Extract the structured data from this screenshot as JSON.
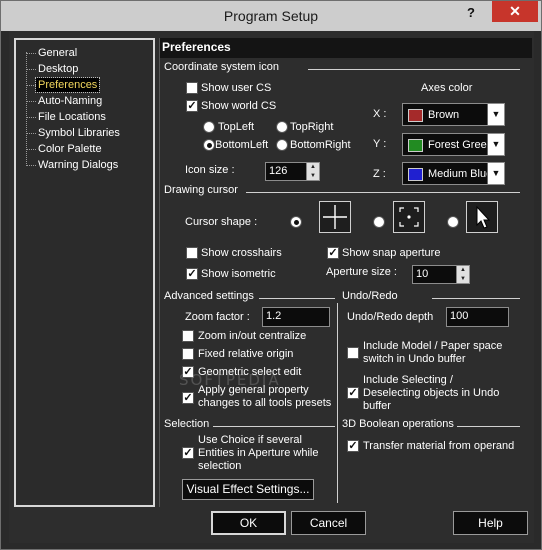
{
  "window": {
    "title": "Program Setup",
    "help_glyph": "?",
    "close_glyph": "✕"
  },
  "tree": {
    "items": [
      {
        "label": "General"
      },
      {
        "label": "Desktop"
      },
      {
        "label": "Preferences"
      },
      {
        "label": "Auto-Naming"
      },
      {
        "label": "File Locations"
      },
      {
        "label": "Symbol Libraries"
      },
      {
        "label": "Color Palette"
      },
      {
        "label": "Warning Dialogs"
      }
    ],
    "selected": "Preferences"
  },
  "panel": {
    "heading": "Preferences",
    "coord": {
      "section": "Coordinate system icon",
      "show_user_cs": "Show user CS",
      "show_world_cs": "Show world CS",
      "topleft": "TopLeft",
      "topright": "TopRight",
      "bottomleft": "BottomLeft",
      "bottomright": "BottomRight",
      "icon_size_label": "Icon size :",
      "icon_size_value": "126",
      "axes_color_label": "Axes color",
      "x_label": "X :",
      "y_label": "Y :",
      "z_label": "Z :",
      "x_color": "Brown",
      "y_color": "Forest Green",
      "z_color": "Medium Blue",
      "x_swatch": "#a52a2a",
      "y_swatch": "#228b22",
      "z_swatch": "#2020d0"
    },
    "cursor": {
      "section": "Drawing cursor",
      "shape_label": "Cursor shape :",
      "show_crosshairs": "Show crosshairs",
      "show_snap_aperture": "Show snap aperture",
      "show_isometric": "Show isometric",
      "aperture_size_label": "Aperture size :",
      "aperture_size_value": "10"
    },
    "advanced": {
      "section": "Advanced settings",
      "zoom_factor_label": "Zoom factor :",
      "zoom_factor_value": "1.2",
      "zoom_centralize": "Zoom in/out centralize",
      "fixed_origin": "Fixed relative origin",
      "geometric_select": "Geometric select edit",
      "apply_general_1": "Apply general property",
      "apply_general_2": "changes to all tools presets"
    },
    "undo": {
      "section": "Undo/Redo",
      "depth_label": "Undo/Redo depth",
      "depth_value": "100",
      "include_model_1": "Include Model / Paper space",
      "include_model_2": "switch in Undo buffer",
      "include_selecting_1": "Include Selecting /",
      "include_selecting_2": "Deselecting objects in Undo",
      "include_selecting_3": "buffer"
    },
    "selection": {
      "section": "Selection",
      "use_choice_1": "Use Choice if several",
      "use_choice_2": "Entities in Aperture while",
      "use_choice_3": "selection",
      "visual_effect_button": "Visual Effect Settings..."
    },
    "boolean": {
      "section": "3D Boolean operations",
      "transfer_material": "Transfer material from operand"
    }
  },
  "footer": {
    "ok": "OK",
    "cancel": "Cancel",
    "help": "Help"
  },
  "watermark": "SOFTPEDIA"
}
